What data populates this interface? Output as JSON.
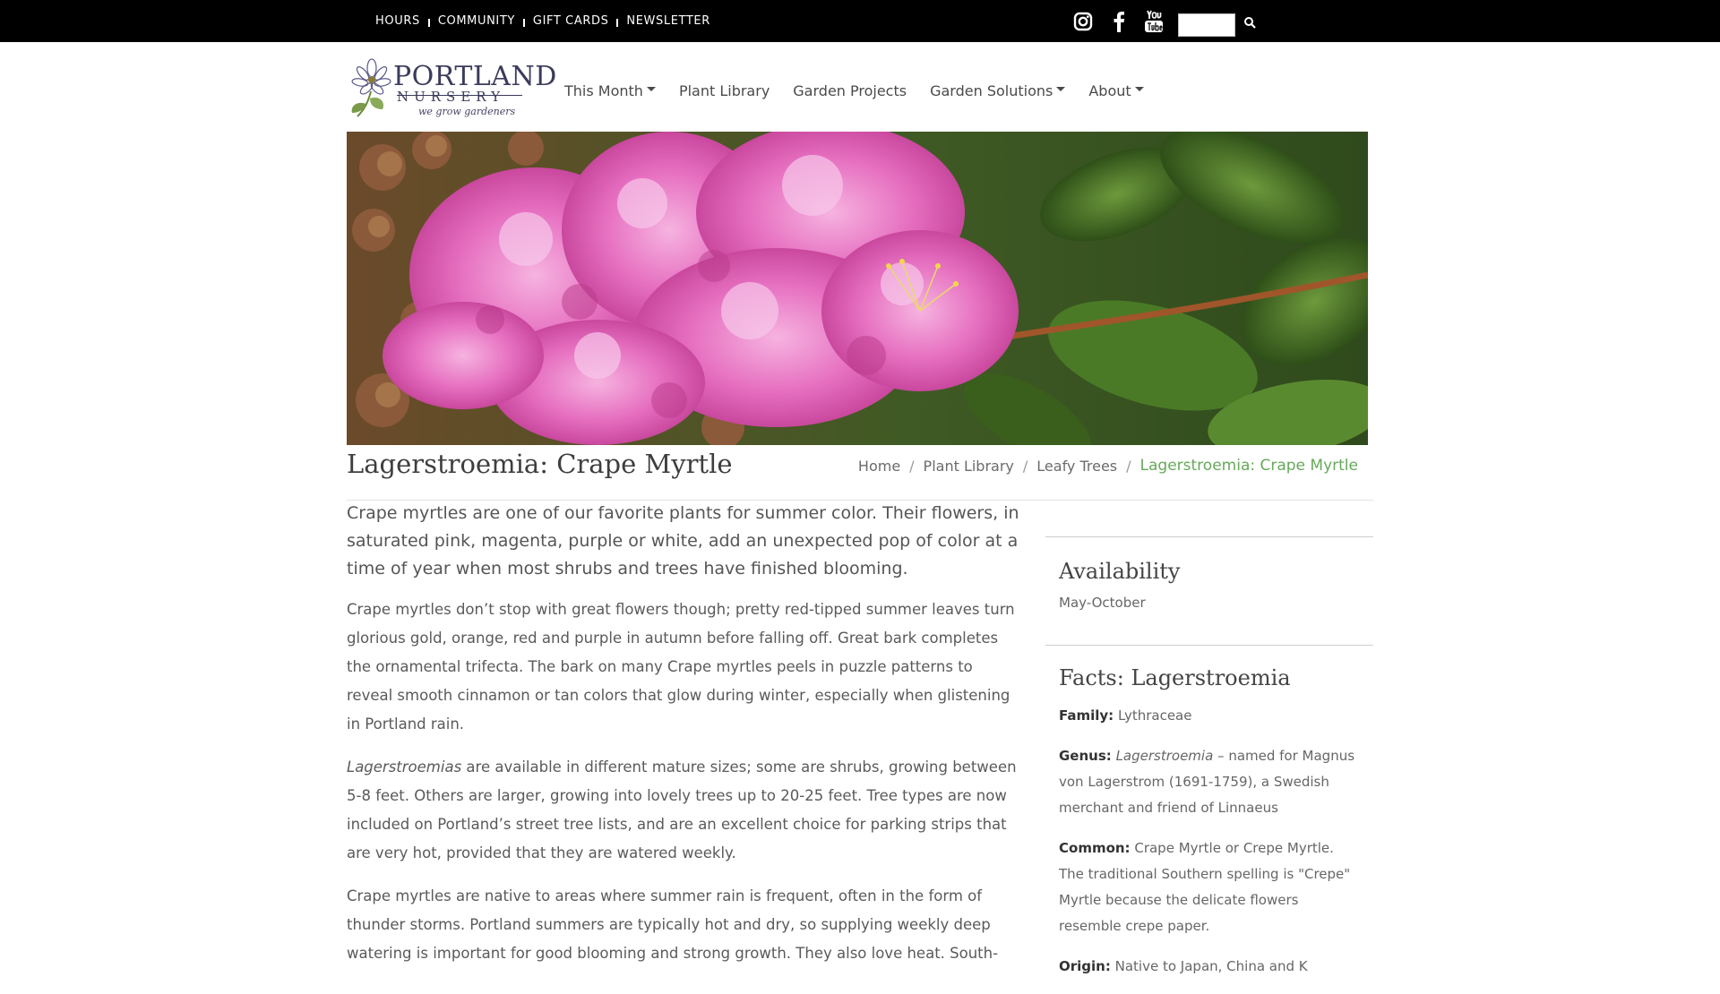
{
  "topbar": {
    "links": [
      "HOURS",
      "COMMUNITY",
      "GIFT CARDS",
      "NEWSLETTER"
    ],
    "social_icons": [
      "instagram-icon",
      "facebook-icon",
      "youtube-icon"
    ],
    "search_placeholder": "",
    "search_icon": "search-icon"
  },
  "logo": {
    "word1": "PORTLAND",
    "word2": "NURSERY",
    "tagline": "we grow gardeners"
  },
  "nav": {
    "items": [
      {
        "label": "This Month",
        "dropdown": true
      },
      {
        "label": "Plant Library",
        "dropdown": false
      },
      {
        "label": "Garden Projects",
        "dropdown": false
      },
      {
        "label": "Garden Solutions",
        "dropdown": true
      },
      {
        "label": "About",
        "dropdown": true
      }
    ]
  },
  "page": {
    "title": "Lagerstroemia: Crape Myrtle",
    "breadcrumb": [
      "Home",
      "Plant Library",
      "Leafy Trees",
      "Lagerstroemia: Crape Myrtle"
    ]
  },
  "content": {
    "lead": "Crape myrtles are one of our favorite plants for summer color. Their flowers, in saturated pink, magenta, purple or white, add an unexpected pop of color at a time of year when most shrubs and trees have finished blooming.",
    "p1": "Crape myrtles don’t stop with great flowers though; pretty red-tipped summer leaves turn glorious gold, orange, red and purple in autumn before falling off. Great bark completes the ornamental trifecta. The bark on many Crape myrtles peels in puzzle patterns to reveal smooth cinnamon or tan colors that glow during winter, especially when glistening in Portland rain.",
    "p2_em": "Lagerstroemias",
    "p2": " are available in different mature sizes; some are shrubs, growing between 5-8 feet. Others are larger, growing into lovely trees up to 20-25 feet. Tree types are now included on Portland’s street tree lists, and are an excellent choice for parking strips that are very hot, provided that they are watered weekly.",
    "p3": "Crape myrtles are native to areas where summer rain is frequent, often in the form of thunder storms. Portland summers are typically hot and dry, so supplying weekly deep watering is important for good blooming and strong growth. They also love heat. South-"
  },
  "sidebar": {
    "availability_heading": "Availability",
    "availability_value": "May-October",
    "facts_heading": "Facts: Lagerstroemia",
    "facts": {
      "family_label": "Family:",
      "family_value": "Lythraceae",
      "genus_label": "Genus:",
      "genus_em": "Lagerstroemia",
      "genus_value": " – named for Magnus von Lagerstrom (1691-1759), a Swedish merchant and friend of Linnaeus",
      "common_label": "Common:",
      "common_value": "Crape Myrtle or Crepe Myrtle. The traditional Southern spelling is \"Crepe\" Myrtle because the delicate flowers resemble crepe paper.",
      "origin_label": "Origin:",
      "origin_value": "Native to Japan, China and K"
    }
  },
  "colors": {
    "topbar_bg": "#000000",
    "accent_green": "#66a95a",
    "text": "#555555"
  }
}
